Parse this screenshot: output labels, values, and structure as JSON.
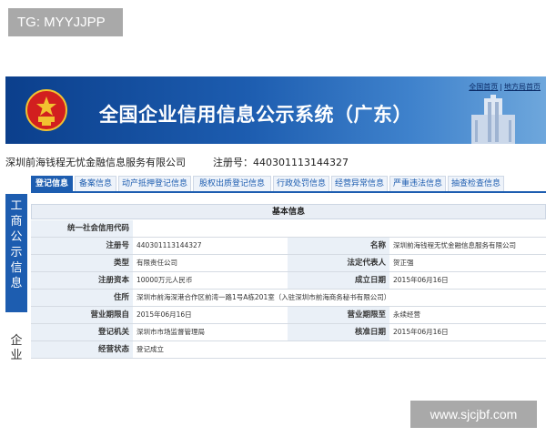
{
  "watermark_top": "TG: MYYJJPP",
  "watermark_bottom": "www.sjcjbf.com",
  "header": {
    "title": "全国企业信用信息公示系统（广东）",
    "link_home": "全国首页",
    "link_local": "地方局首页",
    "link_separator": "|"
  },
  "company": {
    "name": "深圳前海钱程无忧金融信息服务有限公司",
    "reg_label_value": "注册号：440301113144327"
  },
  "sidebar": {
    "primary_chars": [
      "工",
      "商",
      "公",
      "示",
      "信",
      "息"
    ],
    "secondary_chars": [
      "企",
      "业"
    ]
  },
  "tabs": [
    "登记信息",
    "备案信息",
    "动产抵押登记信息",
    "股权出质登记信息",
    "行政处罚信息",
    "经营异常信息",
    "严重违法信息",
    "抽查检查信息"
  ],
  "panel": {
    "title": "基本信息",
    "credit_code_label": "统一社会信用代码",
    "credit_code_value": "",
    "reg_no_label": "注册号",
    "reg_no_value": "440301113144327",
    "name_label": "名称",
    "name_value": "深圳前海钱程无忧金融信息服务有限公司",
    "type_label": "类型",
    "type_value": "有限责任公司",
    "legal_rep_label": "法定代表人",
    "legal_rep_value": "贺正强",
    "capital_label": "注册资本",
    "capital_value": "10000万元人民币",
    "est_date_label": "成立日期",
    "est_date_value": "2015年06月16日",
    "address_label": "住所",
    "address_value": "深圳市前海深港合作区前湾一路1号A栋201室（入驻深圳市前海商务秘书有限公司）",
    "op_from_label": "营业期限自",
    "op_from_value": "2015年06月16日",
    "op_to_label": "营业期限至",
    "op_to_value": "永续经营",
    "authority_label": "登记机关",
    "authority_value": "深圳市市场监督管理局",
    "approval_date_label": "核准日期",
    "approval_date_value": "2015年06月16日",
    "status_label": "经营状态",
    "status_value": "登记成立"
  },
  "colors": {
    "brand_blue": "#1d5db0",
    "banner_dark": "#0b3f8c",
    "emblem_red": "#d21f1f",
    "emblem_gold": "#f2c230"
  },
  "icons": {
    "emblem": "national-emblem-icon",
    "building": "building-icon"
  }
}
